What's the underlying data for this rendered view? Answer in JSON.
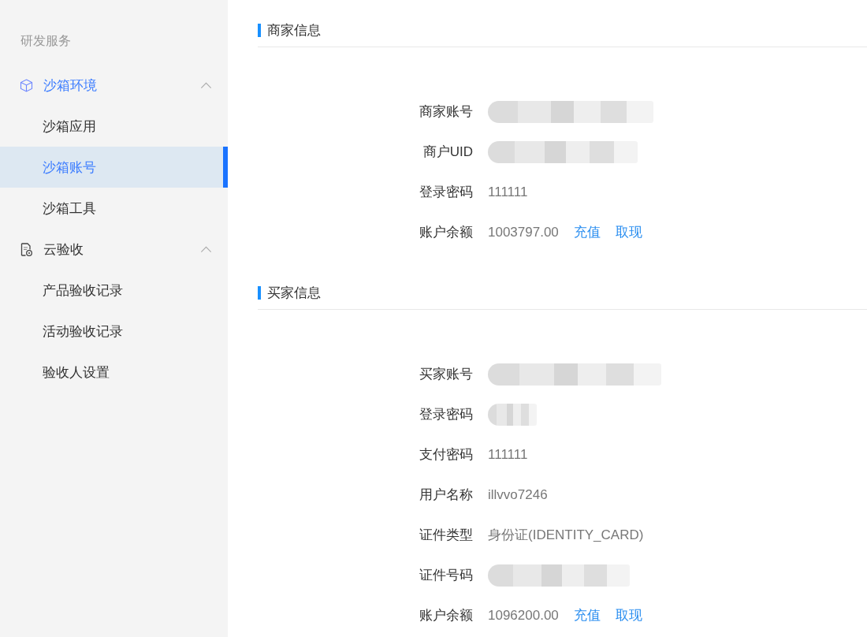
{
  "sidebar": {
    "heading": "研发服务",
    "groups": [
      {
        "label": "沙箱环境",
        "expanded": true,
        "items": [
          {
            "label": "沙箱应用",
            "selected": false
          },
          {
            "label": "沙箱账号",
            "selected": true
          },
          {
            "label": "沙箱工具",
            "selected": false
          }
        ]
      },
      {
        "label": "云验收",
        "expanded": true,
        "items": [
          {
            "label": "产品验收记录",
            "selected": false
          },
          {
            "label": "活动验收记录",
            "selected": false
          },
          {
            "label": "验收人设置",
            "selected": false
          }
        ]
      }
    ]
  },
  "sections": [
    {
      "title": "商家信息",
      "fields": [
        {
          "label": "商家账号",
          "kind": "redacted"
        },
        {
          "label": "商户UID",
          "kind": "redacted"
        },
        {
          "label": "登录密码",
          "kind": "text",
          "value": "111111"
        },
        {
          "label": "账户余额",
          "kind": "balance",
          "value": "1003797.00",
          "actions": [
            "充值",
            "取现"
          ]
        }
      ]
    },
    {
      "title": "买家信息",
      "fields": [
        {
          "label": "买家账号",
          "kind": "redacted"
        },
        {
          "label": "登录密码",
          "kind": "redacted"
        },
        {
          "label": "支付密码",
          "kind": "text",
          "value": "111111"
        },
        {
          "label": "用户名称",
          "kind": "text",
          "value": "illvvo7246"
        },
        {
          "label": "证件类型",
          "kind": "text",
          "value": "身份证(IDENTITY_CARD)"
        },
        {
          "label": "证件号码",
          "kind": "redacted"
        },
        {
          "label": "账户余额",
          "kind": "balance",
          "value": "1096200.00",
          "actions": [
            "充值",
            "取现"
          ]
        }
      ]
    }
  ]
}
